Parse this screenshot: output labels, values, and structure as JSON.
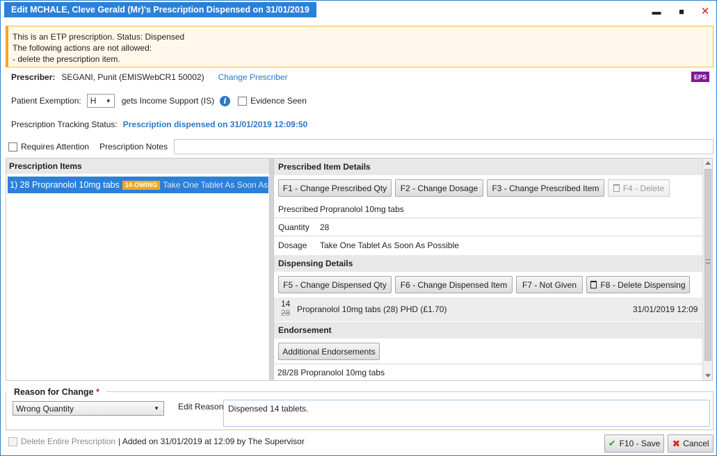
{
  "window": {
    "title": "Edit MCHALE, Cleve Gerald (Mr)'s Prescription Dispensed on 31/01/2019",
    "minimize": "▬",
    "maximize": "■",
    "close": "✕"
  },
  "alert": {
    "line1": "This is an ETP prescription. Status: Dispensed",
    "line2": "The following actions are not allowed:",
    "line3": "- delete the prescription item."
  },
  "prescriber": {
    "label": "Prescriber:",
    "value": "SEGANI, Punit (EMISWebCR1 50002)",
    "change_link": "Change Prescriber",
    "badge": "EPS",
    "badge_color": "#7d1a9d"
  },
  "exemption": {
    "label": "Patient Exemption:",
    "code": "H",
    "description": "gets Income Support (IS)",
    "info_icon": "i",
    "evidence_label": "Evidence Seen"
  },
  "tracking": {
    "label": "Prescription Tracking Status:",
    "value": "Prescription dispensed on 31/01/2019 12:09:50"
  },
  "attention": {
    "requires_label": "Requires Attention",
    "notes_label": "Prescription Notes",
    "notes_value": ""
  },
  "items_panel": {
    "header": "Prescription Items",
    "items": [
      {
        "name": "1) 28 Propranolol 10mg tabs",
        "badge": "14 OWING",
        "dosage": "Take One Tablet As Soon As P..."
      }
    ]
  },
  "prescribed_details": {
    "header": "Prescribed Item Details",
    "buttons": {
      "f1": "F1 - Change Prescribed Qty",
      "f2": "F2 - Change Dosage",
      "f3": "F3 - Change Prescribed Item",
      "f4": "F4 - Delete"
    },
    "rows": [
      {
        "key": "Prescribed",
        "value": "Propranolol 10mg tabs"
      },
      {
        "key": "Quantity",
        "value": "28"
      },
      {
        "key": "Dosage",
        "value": "Take One Tablet As Soon As Possible"
      }
    ]
  },
  "dispensing_details": {
    "header": "Dispensing Details",
    "buttons": {
      "f5": "F5 - Change Dispensed Qty",
      "f6": "F6 - Change Dispensed Item",
      "f7": "F7 - Not Given",
      "f8": "F8 - Delete Dispensing"
    },
    "entry": {
      "dispensed_qty": "14",
      "prescribed_qty": "28",
      "description": "Propranolol 10mg tabs (28) PHD (£1.70)",
      "datetime": "31/01/2019 12:09"
    }
  },
  "endorsement": {
    "header": "Endorsement",
    "button": "Additional Endorsements",
    "line": "28/28 Propranolol 10mg tabs"
  },
  "reason": {
    "legend": "Reason for Change",
    "required_mark": "*",
    "selected": "Wrong Quantity",
    "edit_label": "Edit Reason",
    "edit_value": "Dispensed 14 tablets."
  },
  "footer": {
    "delete_label": "Delete Entire Prescription",
    "added_info": "| Added on 31/01/2019 at 12:09 by The Supervisor",
    "save": "F10 - Save",
    "cancel": "Cancel"
  },
  "colors": {
    "accent": "#2b80d8",
    "owing": "#f5a623",
    "alert_border": "#f5a623",
    "link": "#2a78c4"
  }
}
